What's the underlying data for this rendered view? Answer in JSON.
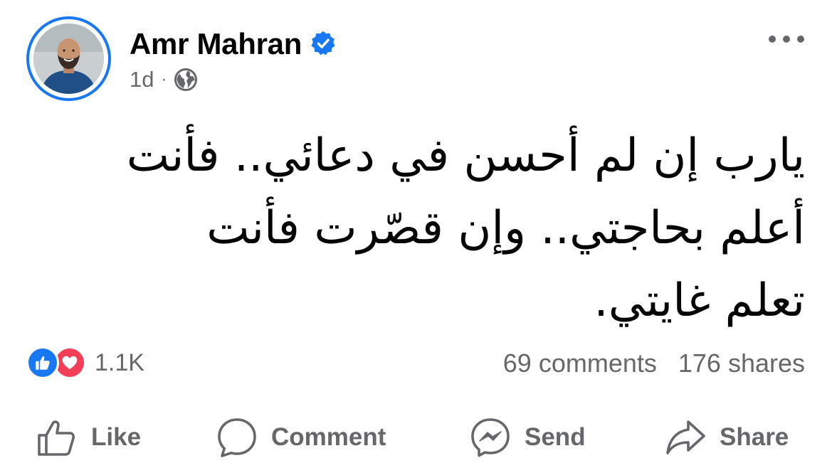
{
  "author": {
    "name": "Amr Mahran",
    "verified": true,
    "avatar_icon": "profile-photo"
  },
  "meta": {
    "time": "1d",
    "separator": "·",
    "audience_icon": "globe-icon"
  },
  "post": {
    "lines": [
      "يارب إن لم أحسن في دعائي.. فأنت",
      "أعلم بحاجتي.. وإن قصّرت فأنت",
      "تعلم غايتي."
    ]
  },
  "reactions": {
    "types": [
      "like",
      "love"
    ],
    "count": "1.1K"
  },
  "stats": {
    "comments": "69 comments",
    "shares": "176 shares"
  },
  "actions": {
    "like": "Like",
    "comment": "Comment",
    "send": "Send",
    "share": "Share"
  },
  "colors": {
    "accent": "#1877f2",
    "love": "#f33e58",
    "secondary_text": "#65676b",
    "primary_text": "#050505"
  }
}
